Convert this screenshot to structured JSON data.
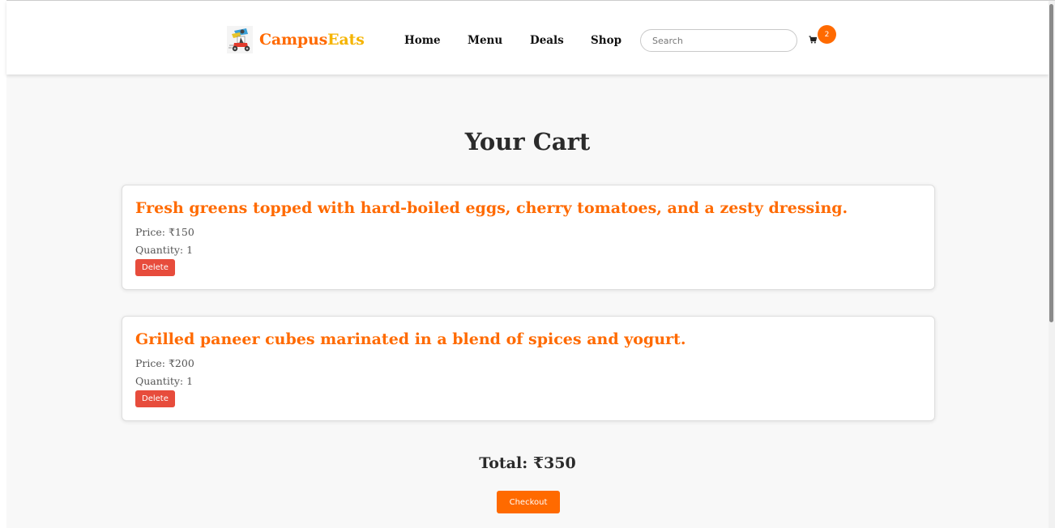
{
  "brand": {
    "part1": "Campus",
    "part2": "Eats"
  },
  "nav": {
    "home": "Home",
    "menu": "Menu",
    "deals": "Deals",
    "shop": "Shop"
  },
  "search": {
    "placeholder": "Search",
    "value": ""
  },
  "cart": {
    "count": "2"
  },
  "page": {
    "title": "Your Cart"
  },
  "items": [
    {
      "title": "Fresh greens topped with hard-boiled eggs, cherry tomatoes, and a zesty dressing.",
      "price": "Price: ₹150",
      "quantity": "Quantity: 1",
      "delete_label": "Delete"
    },
    {
      "title": "Grilled paneer cubes marinated in a blend of spices and yogurt.",
      "price": "Price: ₹200",
      "quantity": "Quantity: 1",
      "delete_label": "Delete"
    }
  ],
  "total": "Total: ₹350",
  "checkout_label": "Checkout",
  "icons": {
    "logo": "delivery-scooter-logo",
    "cart": "shopping-cart-icon"
  },
  "colors": {
    "accent": "#ff6a00",
    "brand_secondary": "#f5b400",
    "delete": "#e74c3c"
  }
}
